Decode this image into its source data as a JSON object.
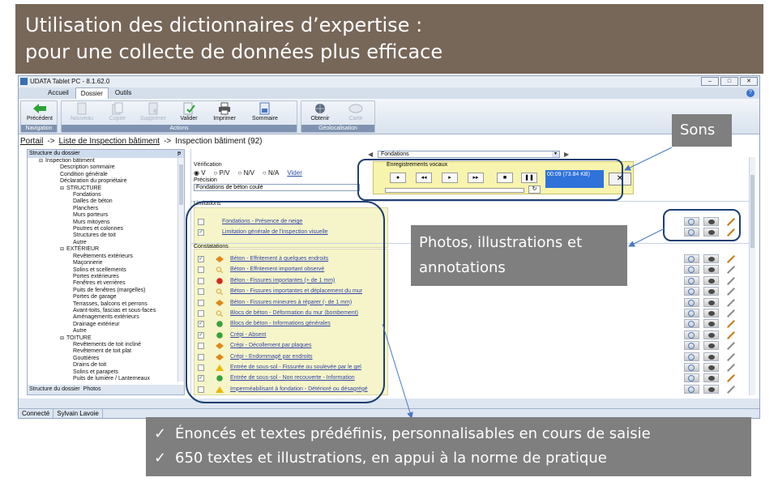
{
  "slide": {
    "title_line1": "Utilisation des dictionnaires d’expertise :",
    "title_line2": "pour une collecte de données plus efficace"
  },
  "window": {
    "title": "UDATA Tablet PC - 8.1.62.0",
    "controls": [
      "–",
      "□",
      "✕"
    ]
  },
  "menu": {
    "tabs": [
      "Accueil",
      "Dossier",
      "Outils"
    ],
    "active": "Dossier",
    "help": "?"
  },
  "ribbon": {
    "groups": {
      "navigation": "Navigation",
      "actions": "Actions",
      "geo": "Géolocalisation"
    },
    "buttons": {
      "precedent": "Précédent",
      "nouveau": "Nouveau",
      "copier": "Copier",
      "supprimer": "Supprimer",
      "valider": "Valider",
      "imprimer": "Imprimer",
      "sommaire": "Sommaire",
      "obtenir": "Obtenir",
      "carte": "Carte"
    }
  },
  "breadcrumb": {
    "portail": "Portail",
    "arrow": "->",
    "liste": "Liste de Inspection bâtiment",
    "current": "Inspection bâtiment (92)"
  },
  "left_panel": {
    "header": "Structure du dossier",
    "pin": "ᵽ",
    "tabs": {
      "structure": "Structure du dossier",
      "photos": "Photos"
    },
    "tree": [
      {
        "label": "Inspection bâtiment",
        "level": 0,
        "group": true
      },
      {
        "label": "Description sommaire",
        "level": 1
      },
      {
        "label": "Condition générale",
        "level": 1
      },
      {
        "label": "Déclaration du propriétaire",
        "level": 1
      },
      {
        "label": "STRUCTURE",
        "level": 1,
        "group": true
      },
      {
        "label": "Fondations",
        "level": 2
      },
      {
        "label": "Dalles de béton",
        "level": 2
      },
      {
        "label": "Planchers",
        "level": 2
      },
      {
        "label": "Murs porteurs",
        "level": 2
      },
      {
        "label": "Murs mitoyens",
        "level": 2
      },
      {
        "label": "Poutres et colonnes",
        "level": 2
      },
      {
        "label": "Structures de toit",
        "level": 2
      },
      {
        "label": "Autre",
        "level": 2
      },
      {
        "label": "EXTÉRIEUR",
        "level": 1,
        "group": true
      },
      {
        "label": "Revêtements extérieurs",
        "level": 2
      },
      {
        "label": "Maçonnerie",
        "level": 2
      },
      {
        "label": "Solins et scellements",
        "level": 2
      },
      {
        "label": "Portes extérieures",
        "level": 2
      },
      {
        "label": "Fenêtres et verrières",
        "level": 2
      },
      {
        "label": "Puits de fenêtres (margelles)",
        "level": 2
      },
      {
        "label": "Portes de garage",
        "level": 2
      },
      {
        "label": "Terrasses, balcons et perrons",
        "level": 2
      },
      {
        "label": "Avant-toits, fascias et sous-faces",
        "level": 2
      },
      {
        "label": "Aménagements extérieurs",
        "level": 2
      },
      {
        "label": "Drainage extérieur",
        "level": 2
      },
      {
        "label": "Autre",
        "level": 2
      },
      {
        "label": "TOITURE",
        "level": 1,
        "group": true
      },
      {
        "label": "Revêtements de toit incliné",
        "level": 2
      },
      {
        "label": "Revêtement de toit plat",
        "level": 2
      },
      {
        "label": "Gouttières",
        "level": 2
      },
      {
        "label": "Drains de toit",
        "level": 2
      },
      {
        "label": "Solins et parapets",
        "level": 2
      },
      {
        "label": "Puits de lumière / Lanterneaux",
        "level": 2
      }
    ]
  },
  "right_panel": {
    "section_select": "Fondations",
    "verification_label": "Vérification",
    "radio_options": [
      "V",
      "P/V",
      "N/V",
      "N/A"
    ],
    "vider": "Vider",
    "precision_label": "Précision",
    "precision_value": "Fondations de béton coulé",
    "audio": {
      "title": "Enregistrements vocaux",
      "buttons": [
        "●",
        "◂◂",
        "▸",
        "▸▸",
        "■",
        "❚❚"
      ],
      "loop": "↻",
      "readout": "00:09 (73.84 KB)",
      "close": "✕"
    },
    "limitations_label": "Limitations",
    "limitations": [
      {
        "text": "Fondations - Présence de neige",
        "checked": false
      },
      {
        "text": "Limitation générale de l'inspection visuelle",
        "checked": true
      }
    ],
    "constatations_label": "Constatations",
    "constatations": [
      {
        "text": "Béton - Effritement à quelques endroits",
        "checked": true,
        "icon": "orange-diamond-icon"
      },
      {
        "text": "Béton - Effritement important observé",
        "checked": false,
        "icon": "magnifier-icon"
      },
      {
        "text": "Béton - Fissures importantes (+ de 1 mm)",
        "checked": false,
        "icon": "stop-icon"
      },
      {
        "text": "Béton - Fissures importantes et déplacement du mur",
        "checked": false,
        "icon": "magnifier-icon"
      },
      {
        "text": "Béton - Fissures mineures à réparer (- de 1 mm)",
        "checked": false,
        "icon": "orange-diamond-icon"
      },
      {
        "text": "Blocs de béton - Déformation du mur (bombement)",
        "checked": false,
        "icon": "magnifier-icon"
      },
      {
        "text": "Blocs de béton - Informations générales",
        "checked": true,
        "icon": "info-icon"
      },
      {
        "text": "Crépi - Absent",
        "checked": true,
        "icon": "info-icon"
      },
      {
        "text": "Crépi - Décollement par plaques",
        "checked": false,
        "icon": "orange-diamond-icon"
      },
      {
        "text": "Crépi - Endommagé par endroits",
        "checked": false,
        "icon": "orange-diamond-icon"
      },
      {
        "text": "Entrée de sous-sol - Fissurée ou soulevée par le gel",
        "checked": false,
        "icon": "warning-icon"
      },
      {
        "text": "Entrée de sous-sol - Non recouverte - Information",
        "checked": true,
        "icon": "info-icon"
      },
      {
        "text": "Imperméabilisant à fondation - Détérioré ou désagrégé",
        "checked": false,
        "icon": "warning-icon"
      }
    ]
  },
  "statusbar": {
    "connected": "Connecté",
    "user": "Sylvain Lavoie"
  },
  "callouts": {
    "sons": "Sons",
    "photos_line1": "Photos, illustrations et",
    "photos_line2": "annotations",
    "check": "✓",
    "bottom_line1": "Énoncés et textes prédéfinis, personnalisables en cours de saisie",
    "bottom_line2": "650 textes et illustrations, en appui à la norme de pratique"
  },
  "colors": {
    "banner": "#776759",
    "callout": "#7f7f7f",
    "highlight_ring": "#1f3f73",
    "yellow_fill": "#f6f5c9",
    "link_text": "#3245a8"
  }
}
